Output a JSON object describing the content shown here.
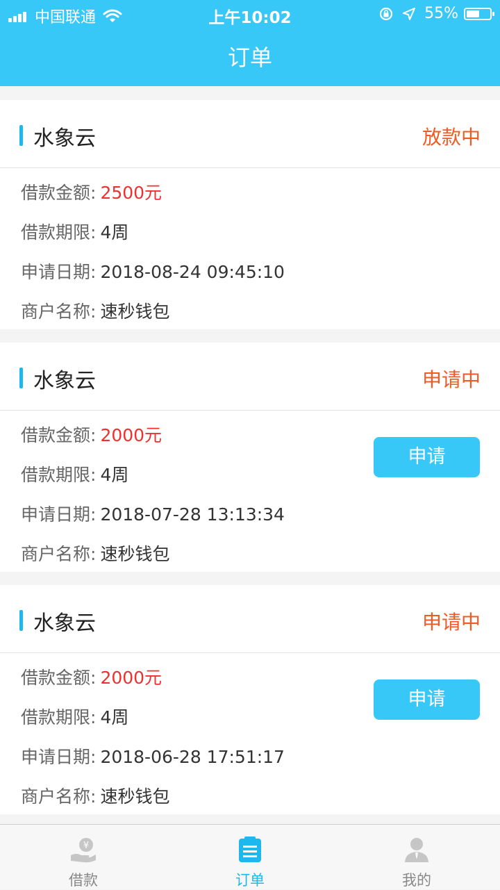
{
  "status_bar": {
    "carrier": "中国联通",
    "time": "上午10:02",
    "battery_text": "55%",
    "battery_level": 0.55
  },
  "nav": {
    "title": "订单"
  },
  "labels": {
    "amount": "借款金额:",
    "term": "借款期限:",
    "date": "申请日期:",
    "merchant": "商户名称:"
  },
  "orders": [
    {
      "name": "水象云",
      "status": "放款中",
      "amount": "2500元",
      "term": "4周",
      "date": "2018-08-24 09:45:10",
      "merchant": "速秒钱包",
      "button": ""
    },
    {
      "name": "水象云",
      "status": "申请中",
      "amount": "2000元",
      "term": "4周",
      "date": "2018-07-28 13:13:34",
      "merchant": "速秒钱包",
      "button": "申请"
    },
    {
      "name": "水象云",
      "status": "申请中",
      "amount": "2000元",
      "term": "4周",
      "date": "2018-06-28 17:51:17",
      "merchant": "速秒钱包",
      "button": "申请"
    }
  ],
  "tabs": [
    {
      "label": "借款",
      "icon": "loan-hand-coin-icon",
      "active": false
    },
    {
      "label": "订单",
      "icon": "order-list-icon",
      "active": true
    },
    {
      "label": "我的",
      "icon": "user-profile-icon",
      "active": false
    }
  ],
  "colors": {
    "primary": "#38c8f8",
    "accent_bar": "#1cb8ee",
    "status_orange": "#f25a23",
    "amount_red": "#ee3030"
  }
}
